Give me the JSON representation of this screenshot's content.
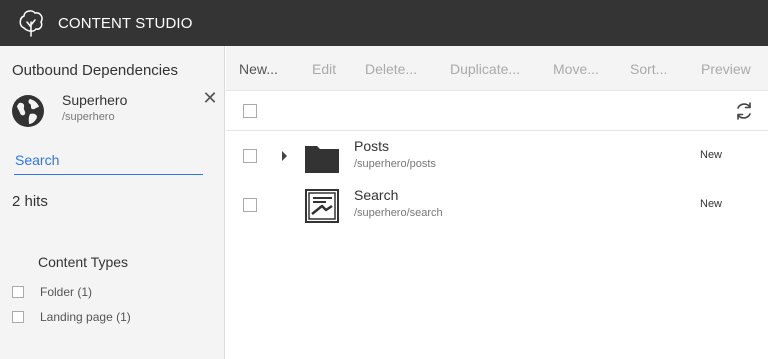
{
  "app": {
    "title": "CONTENT STUDIO"
  },
  "sidebar": {
    "filter_title": "Outbound Dependencies",
    "reference": {
      "name": "Superhero",
      "path": "/superhero",
      "icon": "globe-icon"
    },
    "close_label": "✕",
    "search": {
      "placeholder": "Search",
      "value": ""
    },
    "hits": "2 hits",
    "aggregation": {
      "title": "Content Types",
      "items": [
        {
          "label": "Folder (1)",
          "checked": false
        },
        {
          "label": "Landing page (1)",
          "checked": false
        }
      ]
    }
  },
  "toolbar": {
    "buttons": [
      {
        "label": "New...",
        "enabled": true
      },
      {
        "label": "Edit",
        "enabled": false
      },
      {
        "label": "Delete...",
        "enabled": false
      },
      {
        "label": "Duplicate...",
        "enabled": false
      },
      {
        "label": "Move...",
        "enabled": false
      },
      {
        "label": "Sort...",
        "enabled": false
      },
      {
        "label": "Preview",
        "enabled": false
      }
    ]
  },
  "grid": {
    "rows": [
      {
        "name": "Posts",
        "path": "/superhero/posts",
        "status": "New",
        "icon": "folder-icon",
        "expandable": true
      },
      {
        "name": "Search",
        "path": "/superhero/search",
        "status": "New",
        "icon": "landing-page-icon",
        "expandable": false
      }
    ]
  },
  "colors": {
    "topbar": "#343434",
    "accent": "#2c76e9",
    "panel": "#f4f4f4"
  }
}
